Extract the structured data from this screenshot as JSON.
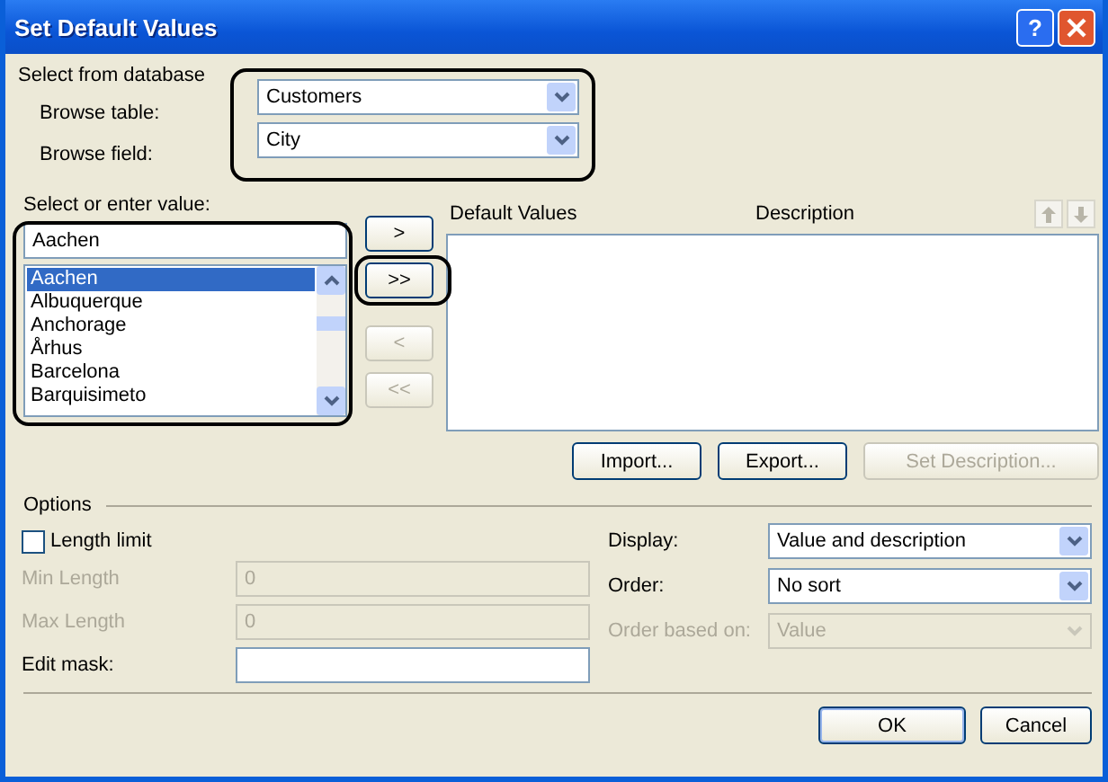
{
  "window": {
    "title": "Set Default Values",
    "help": "?"
  },
  "database": {
    "heading": "Select from database",
    "highlighted": true,
    "fields": [
      {
        "label": "Browse table:",
        "value": "Customers"
      },
      {
        "label": "Browse field:",
        "value": "City"
      }
    ]
  },
  "values": {
    "label": "Select or enter value:",
    "input": "Aachen",
    "highlighted": true,
    "items": [
      {
        "label": "Aachen",
        "selected": true
      },
      {
        "label": "Albuquerque",
        "selected": false
      },
      {
        "label": "Anchorage",
        "selected": false
      },
      {
        "label": "Århus",
        "selected": false
      },
      {
        "label": "Barcelona",
        "selected": false
      },
      {
        "label": "Barquisimeto",
        "selected": false
      }
    ]
  },
  "move_buttons": [
    {
      "label": ">",
      "disabled": false,
      "highlighted": false
    },
    {
      "label": ">>",
      "disabled": false,
      "highlighted": true
    },
    {
      "label": "<",
      "disabled": true,
      "highlighted": false
    },
    {
      "label": "<<",
      "disabled": true,
      "highlighted": false
    }
  ],
  "default_values": {
    "columns": [
      "Default Values",
      "Description"
    ],
    "actions": [
      {
        "label": "Import...",
        "disabled": false
      },
      {
        "label": "Export...",
        "disabled": false
      },
      {
        "label": "Set Description...",
        "disabled": true
      }
    ]
  },
  "options": {
    "heading": "Options",
    "length_limit": {
      "label": "Length limit",
      "checked": false
    },
    "fields": [
      {
        "label": "Min Length",
        "value": "0",
        "disabled": true
      },
      {
        "label": "Max Length",
        "value": "0",
        "disabled": true
      },
      {
        "label": "Edit mask:",
        "disabled": false
      }
    ],
    "selects": [
      {
        "label": "Display:",
        "value": "Value and description",
        "disabled": false
      },
      {
        "label": "Order:",
        "value": "No sort",
        "disabled": false
      },
      {
        "label": "Order based on:",
        "value": "Value",
        "disabled": true
      }
    ]
  },
  "footer_buttons": [
    {
      "label": "OK",
      "default": true
    },
    {
      "label": "Cancel",
      "default": false
    }
  ]
}
